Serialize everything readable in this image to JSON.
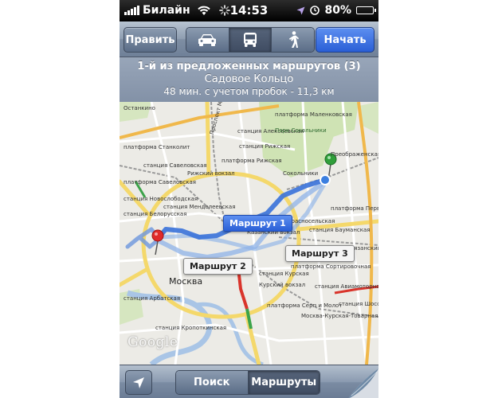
{
  "status_bar": {
    "carrier": "Билайн",
    "time": "14:53",
    "battery": "80%",
    "battery_level": 0.8
  },
  "nav_bar": {
    "edit_label": "Править",
    "modes": [
      {
        "name": "car-icon",
        "active": false
      },
      {
        "name": "bus-icon",
        "active": true
      },
      {
        "name": "walk-icon",
        "active": false
      }
    ],
    "start_label": "Начать"
  },
  "route_info": {
    "title": "1-й из предложенных маршрутов (3)",
    "road": "Садовое Кольцо",
    "eta": "48 мин. с учетом пробок - 11,3 км"
  },
  "map": {
    "callouts": {
      "route1": "Маршрут 1",
      "route2": "Маршрут 2",
      "route3": "Маршрут 3"
    },
    "labels": {
      "moskva": "Москва",
      "ostankino": "Останкино",
      "malenkovskaya": "платформа Маленковская",
      "alekseevskaya": "станция Алексеевская",
      "rizhskaya_st": "станция Рижская",
      "rizhskaya_pl": "платформа Рижская",
      "rizhsky_vokzal": "Рижский вокзал",
      "stankolit": "платформа Станколит",
      "savelovskaya": "станция Савеловская",
      "savelovskaya_pl": "платформа Савеловская",
      "novoslobodskaya": "станция Новослободская",
      "belorusskaya": "станция Белорусская",
      "mendeleevskaya": "станция Менделеевская",
      "sokolniki": "Сокольники",
      "sokolniki_park": "Парк Сокольники",
      "krasnoselskaya": "станция Красносельская",
      "kazansky": "Казанский вокзал",
      "baumanskaya": "станция Бауманская",
      "kurskaya": "станция Курская",
      "kursky": "Курский вокзал",
      "sortirovochnaya": "платформа Сортировочная",
      "arbatskaya": "станция Арбатская",
      "kropotkinskaya": "станция Кропоткинская",
      "serp_i_molot": "платформа Серп и Молот",
      "moskva_kurskaya": "Москва-Курская-Товарная",
      "aviamotornaya": "станция Авиамоторная",
      "ryazanskiy": "Рязанский",
      "preobrazhenskaya": "Преображенская",
      "pervomayskaya": "платформа Первомайская",
      "shosse_entuziastov": "станция Шоссе Энтузиастов",
      "prospekt_mira": "Проспект Мира"
    },
    "google": "Google"
  },
  "toolbar": {
    "search_label": "Поиск",
    "routes_label": "Маршруты"
  }
}
